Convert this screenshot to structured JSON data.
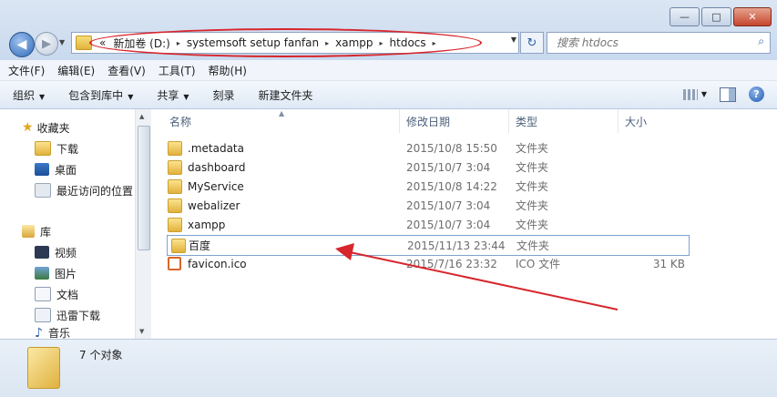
{
  "window": {
    "min_label": "—",
    "max_label": "□",
    "close_label": "✕"
  },
  "nav": {
    "back_icon": "arrow-left-icon",
    "forward_icon": "arrow-right-icon"
  },
  "address": {
    "overflow": "«",
    "crumbs": [
      "新加卷 (D:)",
      "systemsoft setup fanfan",
      "xampp",
      "htdocs"
    ],
    "separator": "▸"
  },
  "search": {
    "placeholder": "搜索 htdocs"
  },
  "menu": [
    "文件(F)",
    "编辑(E)",
    "查看(V)",
    "工具(T)",
    "帮助(H)"
  ],
  "toolbar": {
    "organize": "组织",
    "include_library": "包含到库中",
    "share": "共享",
    "burn": "刻录",
    "new_folder": "新建文件夹"
  },
  "sidebar": {
    "favorites": "收藏夹",
    "downloads": "下载",
    "desktop": "桌面",
    "recent": "最近访问的位置",
    "libraries": "库",
    "videos": "视频",
    "pictures": "图片",
    "documents": "文档",
    "thunder": "迅雷下载",
    "music": "音乐"
  },
  "columns": {
    "name": "名称",
    "date": "修改日期",
    "type": "类型",
    "size": "大小"
  },
  "files": [
    {
      "name": ".metadata",
      "date": "2015/10/8 15:50",
      "type": "文件夹",
      "size": "",
      "kind": "folder"
    },
    {
      "name": "dashboard",
      "date": "2015/10/7 3:04",
      "type": "文件夹",
      "size": "",
      "kind": "folder"
    },
    {
      "name": "MyService",
      "date": "2015/10/8 14:22",
      "type": "文件夹",
      "size": "",
      "kind": "folder"
    },
    {
      "name": "webalizer",
      "date": "2015/10/7 3:04",
      "type": "文件夹",
      "size": "",
      "kind": "folder"
    },
    {
      "name": "xampp",
      "date": "2015/10/7 3:04",
      "type": "文件夹",
      "size": "",
      "kind": "folder"
    },
    {
      "name": "百度",
      "date": "2015/11/13 23:44",
      "type": "文件夹",
      "size": "",
      "kind": "folder"
    },
    {
      "name": "favicon.ico",
      "date": "2015/7/16 23:32",
      "type": "ICO 文件",
      "size": "31 KB",
      "kind": "ico"
    }
  ],
  "status": {
    "count": "7 个对象"
  },
  "annotation_color": "#d7262d"
}
